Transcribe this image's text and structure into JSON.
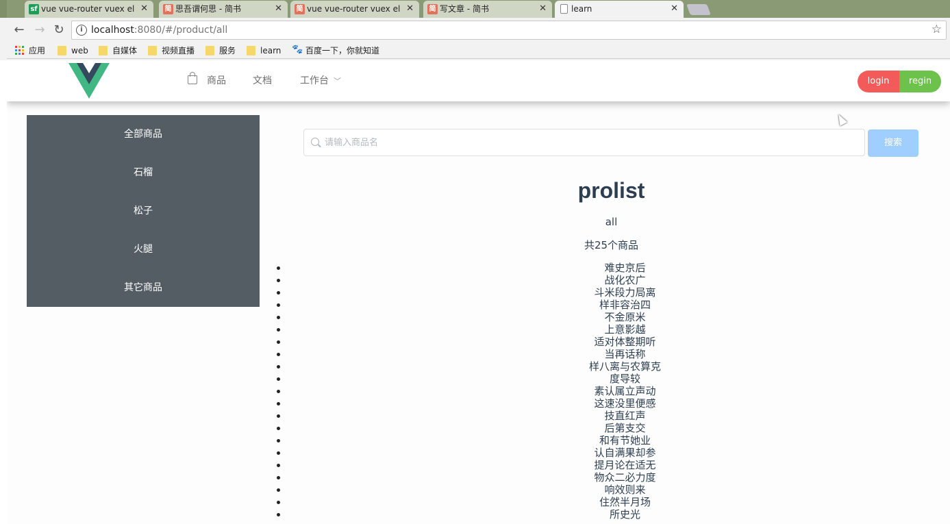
{
  "browser": {
    "tabs": [
      {
        "title": "vue vue-router vuex el",
        "favicon": "sf",
        "favicon_color": "#1d9e57"
      },
      {
        "title": "思吾谓何思 - 简书",
        "favicon": "简",
        "favicon_color": "#e0735b"
      },
      {
        "title": "vue vue-router vuex el",
        "favicon": "简",
        "favicon_color": "#e0735b"
      },
      {
        "title": "写文章 - 简书",
        "favicon": "简",
        "favicon_color": "#e0735b"
      },
      {
        "title": "learn",
        "favicon": "page",
        "favicon_color": "#ffffff",
        "active": true
      }
    ],
    "url_host": "localhost",
    "url_path": ":8080/#/product/all",
    "bookmarks": [
      "应用",
      "web",
      "自媒体",
      "视频直播",
      "服务",
      "learn",
      "百度一下，你就知道"
    ]
  },
  "header": {
    "menu": {
      "products": "商品",
      "docs": "文档",
      "workbench": "工作台"
    },
    "login": "login",
    "regin": "regin"
  },
  "sidebar": {
    "items": [
      "全部商品",
      "石榴",
      "松子",
      "火腿",
      "其它商品"
    ]
  },
  "search": {
    "placeholder": "请输入商品名",
    "button": "搜索"
  },
  "content": {
    "title": "prolist",
    "category": "all",
    "count_text": "共25个商品",
    "products": [
      "难史京后",
      "战化农广",
      "斗米段力局离",
      "样非容治四",
      "不金原米",
      "上意影越",
      "适对体整期听",
      "当再话称",
      "样八离与农算克",
      "度导较",
      "素认属立声动",
      "这速没里便感",
      "技直红声",
      "后第支交",
      "和有节她业",
      "认自满果却参",
      "提月论在适无",
      "物众二必力度",
      "响效则来",
      "住然半月场",
      "所史光"
    ]
  },
  "colors": {
    "sidebar_bg": "#545c64",
    "login_bg": "#f35a5a",
    "regin_bg": "#6cc24a",
    "search_btn_bg": "#a0cfff",
    "vue_green": "#41b883",
    "vue_dark": "#35495e"
  }
}
